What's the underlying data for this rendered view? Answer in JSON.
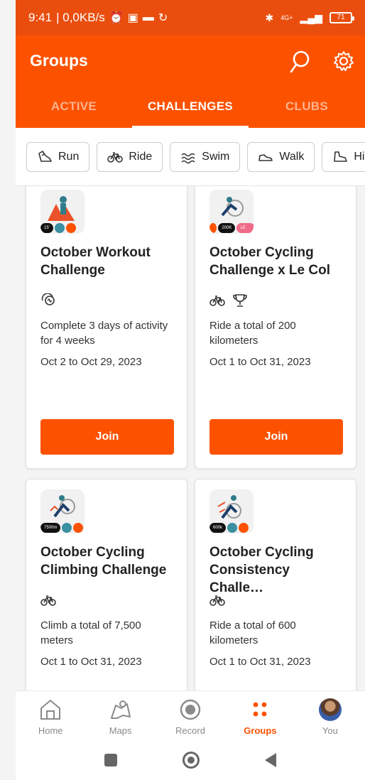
{
  "status_bar": {
    "time": "9:41",
    "network_speed": "| 0,0KB/s",
    "network": "4G+",
    "battery": "71"
  },
  "app_bar": {
    "title": "Groups"
  },
  "tabs": [
    {
      "label": "ACTIVE",
      "active": false
    },
    {
      "label": "CHALLENGES",
      "active": true
    },
    {
      "label": "CLUBS",
      "active": false
    }
  ],
  "filters": [
    {
      "label": "Run",
      "icon": "shoe-icon"
    },
    {
      "label": "Ride",
      "icon": "bike-icon"
    },
    {
      "label": "Swim",
      "icon": "waves-icon"
    },
    {
      "label": "Walk",
      "icon": "walk-shoe-icon"
    },
    {
      "label": "Hike",
      "icon": "hike-boot-icon"
    }
  ],
  "challenges": [
    {
      "title": "October Workout Challenge",
      "badge_text": "15'",
      "icons": [
        "activity-icon"
      ],
      "description": "Complete 3 days of activity for 4 weeks",
      "dates": "Oct 2 to Oct 29, 2023",
      "join_label": "Join"
    },
    {
      "title": "October Cycling Challenge x Le Col",
      "badge_text": "200K",
      "badge_text_2": "LE COL",
      "icons": [
        "bike-icon",
        "trophy-icon"
      ],
      "description": "Ride a total of 200 kilometers",
      "dates": "Oct 1 to Oct 31, 2023",
      "join_label": "Join"
    },
    {
      "title": "October Cycling Climbing Challenge",
      "badge_text": "7500m",
      "icons": [
        "bike-icon"
      ],
      "description": "Climb a total of 7,500 meters",
      "dates": "Oct 1 to Oct 31, 2023"
    },
    {
      "title": "October Cycling Consistency Challe…",
      "badge_text": "600k",
      "icons": [
        "bike-icon"
      ],
      "description": "Ride a total of 600 kilometers",
      "dates": "Oct 1 to Oct 31, 2023"
    }
  ],
  "bottom_nav": [
    {
      "label": "Home",
      "icon": "home-icon",
      "active": false
    },
    {
      "label": "Maps",
      "icon": "map-icon",
      "active": false
    },
    {
      "label": "Record",
      "icon": "record-icon",
      "active": false
    },
    {
      "label": "Groups",
      "icon": "groups-icon",
      "active": true
    },
    {
      "label": "You",
      "icon": "avatar",
      "active": false
    }
  ],
  "colors": {
    "brand": "#fc5200",
    "status_bar": "#e94e0e"
  }
}
